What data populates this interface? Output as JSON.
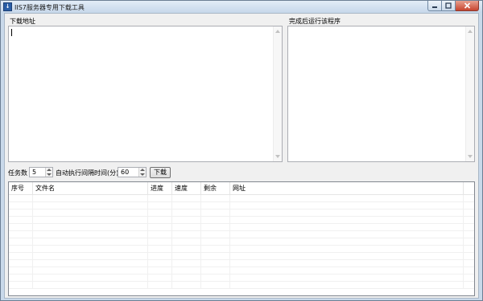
{
  "window": {
    "title": "IIS7服务器专用下载工具",
    "icon": "app-logo-icon",
    "buttons": [
      "minimize-icon",
      "maximize-icon",
      "close-icon"
    ]
  },
  "download_urls": {
    "label": "下载地址",
    "value": ""
  },
  "run_after": {
    "label": "完成后运行该程序",
    "value": ""
  },
  "controls": {
    "task_count_label": "任务数",
    "task_count_value": "5",
    "interval_label": "自动执行间隔时间(分)",
    "interval_value": "60",
    "download_button": "下载"
  },
  "table": {
    "columns": [
      "序号",
      "文件名",
      "进度",
      "速度",
      "剩余",
      "网址"
    ],
    "rows": []
  },
  "colors": {
    "title_text": "#1a1a1a",
    "close_button": "#c7452f",
    "window_frame": "#c9d9ea"
  }
}
